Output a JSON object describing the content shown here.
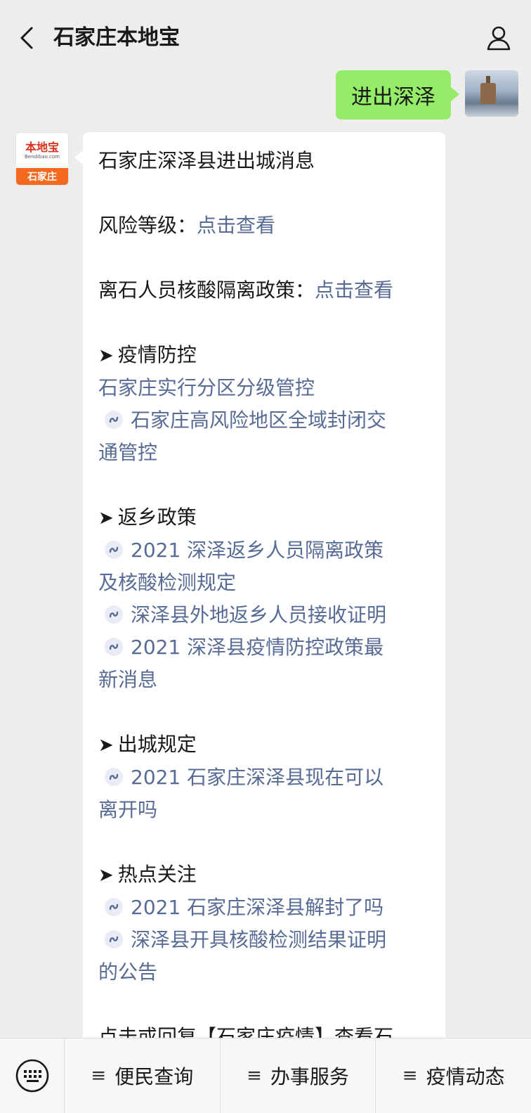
{
  "header": {
    "title": "石家庄本地宝"
  },
  "outgoing": {
    "text": "进出深泽"
  },
  "bot_avatar": {
    "name": "本地宝",
    "url": "Bendibao.com",
    "city": "石家庄"
  },
  "message": {
    "title": "石家庄深泽县进出城消息",
    "risk_label": "风险等级：",
    "risk_link": "点击查看",
    "policy_label": "离石人员核酸隔离政策：",
    "policy_link": "点击查看",
    "sections": [
      {
        "head": "疫情防控",
        "lines": [
          {
            "type": "plain",
            "text": "石家庄实行分区分级管控"
          },
          {
            "type": "mp",
            "text": "石家庄高风险地区全域封闭交"
          },
          {
            "type": "cont",
            "text": "通管控"
          }
        ]
      },
      {
        "head": "返乡政策",
        "lines": [
          {
            "type": "mp",
            "text": "2021 深泽返乡人员隔离政策"
          },
          {
            "type": "cont",
            "text": "及核酸检测规定"
          },
          {
            "type": "mp",
            "text": "深泽县外地返乡人员接收证明"
          },
          {
            "type": "mp",
            "text": "2021 深泽县疫情防控政策最"
          },
          {
            "type": "cont",
            "text": "新消息"
          }
        ]
      },
      {
        "head": "出城规定",
        "lines": [
          {
            "type": "mp",
            "text": "2021 石家庄深泽县现在可以"
          },
          {
            "type": "cont",
            "text": "离开吗"
          }
        ]
      },
      {
        "head": "热点关注",
        "lines": [
          {
            "type": "mp",
            "text": "2021 石家庄深泽县解封了吗"
          },
          {
            "type": "mp",
            "text": "深泽县开具核酸检测结果证明"
          },
          {
            "type": "cont",
            "text": "的公告"
          }
        ]
      }
    ],
    "cut_line": "点击或回复【石家庄疫情】查看石"
  },
  "bottom_menu": {
    "items": [
      "便民查询",
      "办事服务",
      "疫情动态"
    ]
  }
}
